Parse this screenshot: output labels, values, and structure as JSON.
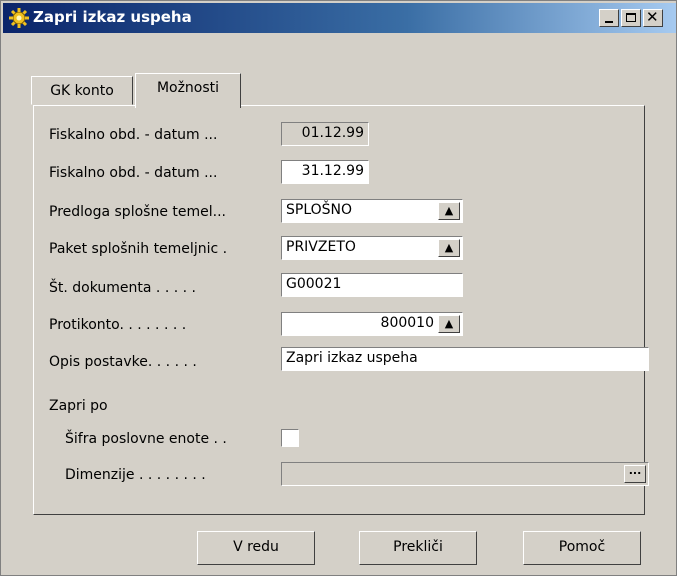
{
  "window": {
    "title": "Zapri izkaz uspeha",
    "icon": "gear-icon"
  },
  "tabs": [
    {
      "label": "GK konto",
      "active": false
    },
    {
      "label": "Možnosti",
      "active": true
    }
  ],
  "fields": {
    "fiscal_start": {
      "label": "Fiskalno obd. - datum ...",
      "value": "01.12.99"
    },
    "fiscal_end": {
      "label": "Fiskalno obd. - datum ...",
      "value": "31.12.99"
    },
    "template": {
      "label": "Predloga splošne temel...",
      "value": "SPLOŠNO"
    },
    "batch": {
      "label": "Paket splošnih temeljnic .",
      "value": "PRIVZETO"
    },
    "doc_no": {
      "label": "Št. dokumenta . . . . .",
      "value": "G00021"
    },
    "balance_account": {
      "label": "Protikonto. . . . . . . .",
      "value": "800010"
    },
    "description": {
      "label": "Opis postavke. . . . . .",
      "value": "Zapri izkaz uspeha"
    }
  },
  "close_by": {
    "section_label": "Zapri po",
    "business_unit_label": "Šifra poslovne enote . .",
    "business_unit_checked": false,
    "dimensions_label": "Dimenzije . . . . . . . .",
    "dimensions_value": "",
    "dots_label": "..."
  },
  "buttons": {
    "ok": "V redu",
    "cancel": "Prekliči",
    "help": "Pomoč"
  }
}
